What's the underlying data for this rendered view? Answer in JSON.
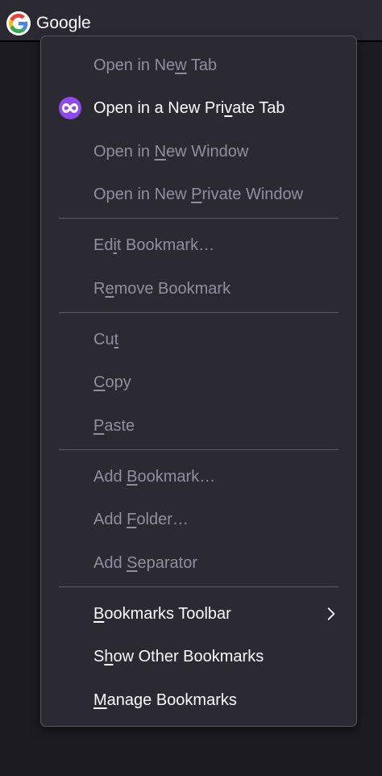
{
  "toolbar": {
    "bookmark_label": "Google",
    "bookmark_icon": "google-g-icon"
  },
  "menu": {
    "open_new_tab": {
      "before": "Open in Ne",
      "key": "w",
      "after": " Tab"
    },
    "open_private_tab": {
      "before": "Open in a New Pri",
      "key": "v",
      "after": "ate Tab",
      "icon": "private-browsing-icon"
    },
    "open_new_window": {
      "before": "Open in ",
      "key": "N",
      "after": "ew Window"
    },
    "open_private_window": {
      "before": "Open in New ",
      "key": "P",
      "after": "rivate Window"
    },
    "edit_bookmark": {
      "before": "Ed",
      "key": "i",
      "after": "t Bookmark…"
    },
    "remove_bookmark": {
      "before": "R",
      "key": "e",
      "after": "move Bookmark"
    },
    "cut": {
      "before": "Cu",
      "key": "t",
      "after": ""
    },
    "copy": {
      "before": "",
      "key": "C",
      "after": "opy"
    },
    "paste": {
      "before": "",
      "key": "P",
      "after": "aste"
    },
    "add_bookmark": {
      "before": "Add ",
      "key": "B",
      "after": "ookmark…"
    },
    "add_folder": {
      "before": "Add ",
      "key": "F",
      "after": "older…"
    },
    "add_separator": {
      "before": "Add ",
      "key": "S",
      "after": "eparator"
    },
    "bookmarks_toolbar": {
      "before": "",
      "key": "B",
      "after": "ookmarks Toolbar",
      "icon": "chevron-right-icon"
    },
    "show_other": {
      "before": "S",
      "key": "h",
      "after": "ow Other Bookmarks"
    },
    "manage_bookmarks": {
      "before": "",
      "key": "M",
      "after": "anage Bookmarks"
    }
  },
  "colors": {
    "menu_bg": "#2b2a33",
    "text_enabled": "#fbfbfe",
    "text_disabled": "#8f8f9d",
    "private_accent": "#8f49ee"
  }
}
